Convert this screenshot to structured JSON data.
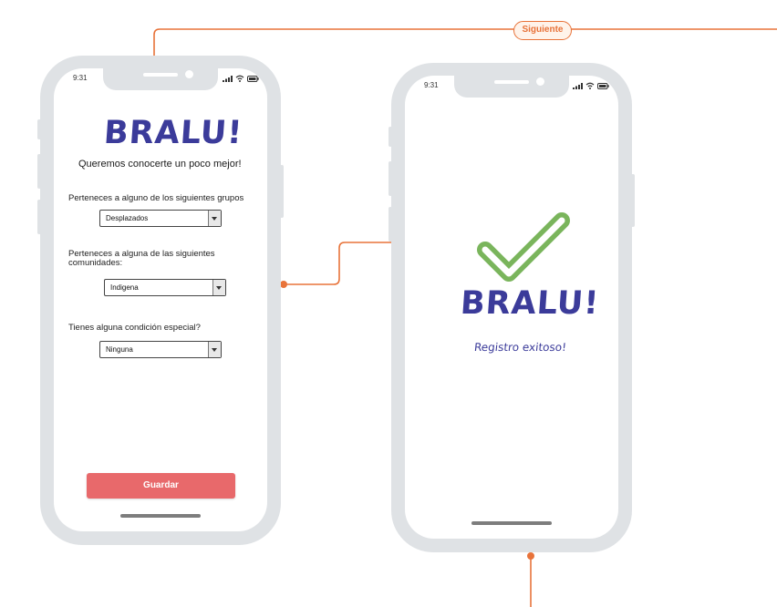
{
  "flow": {
    "connector_label": "Siguiente",
    "connector_color": "#e8733a"
  },
  "screen_form": {
    "status_time": "9:31",
    "logo": "BRALU!",
    "subtitle": "Queremos conocerte un poco mejor!",
    "questions": [
      {
        "label": "Perteneces a alguno de los siguientes grupos",
        "value": "Desplazados"
      },
      {
        "label": "Perteneces a alguna de las siguientes comunidades:",
        "value": "Indigena"
      },
      {
        "label": "Tienes alguna condición especial?",
        "value": "Ninguna"
      }
    ],
    "save_label": "Guardar"
  },
  "screen_success": {
    "status_time": "9:31",
    "icon": "checkmark-icon",
    "logo": "BRALU!",
    "message": "Registro exitoso!"
  },
  "colors": {
    "brand": "#3b3b9a",
    "accent_button": "#e8696b",
    "success_check": "#7ab55c",
    "device_frame": "#dfe2e5"
  }
}
